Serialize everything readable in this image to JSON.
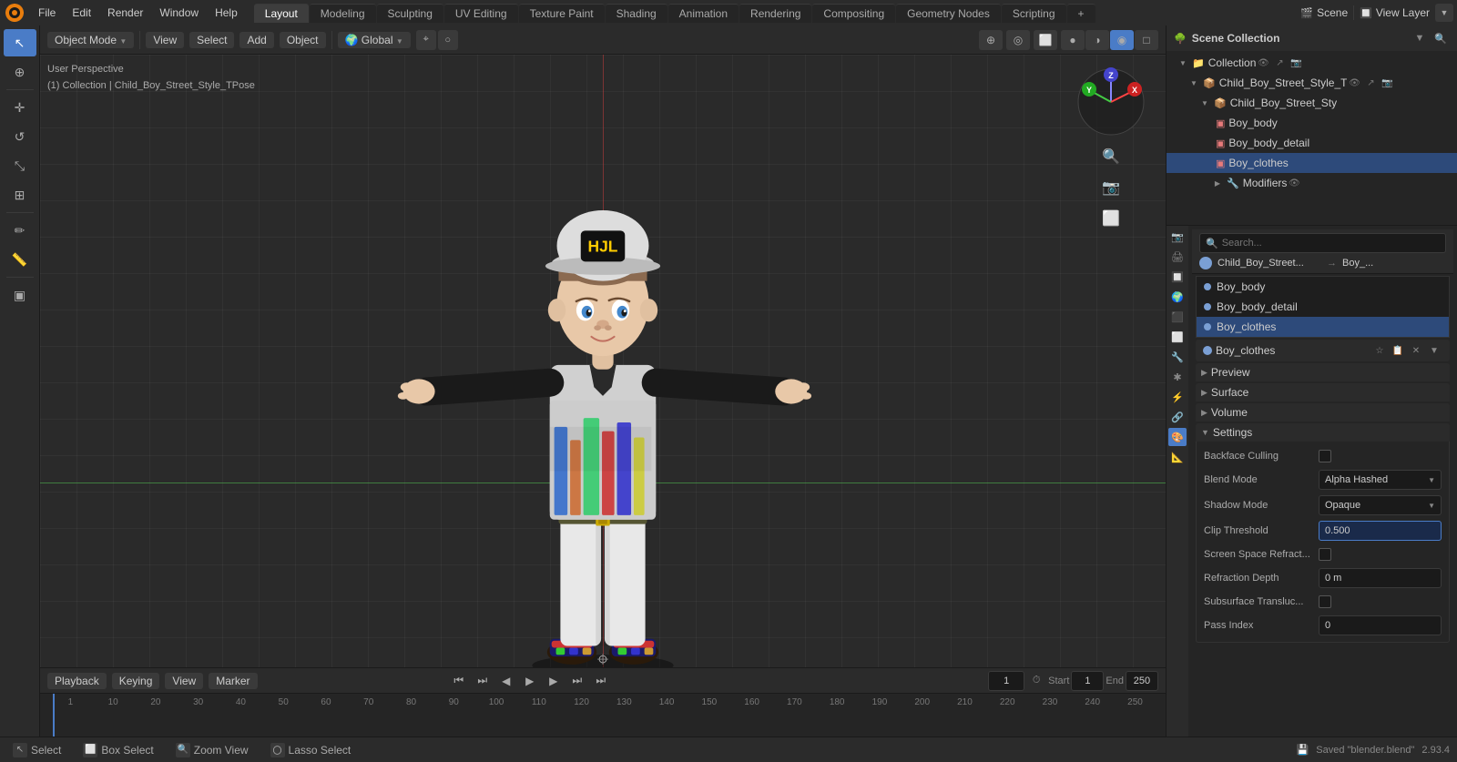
{
  "app": {
    "name": "Blender",
    "version": "2.93.4"
  },
  "topmenu": {
    "items": [
      "Blender",
      "File",
      "Edit",
      "Render",
      "Window",
      "Help"
    ],
    "workspace_tabs": [
      "Layout",
      "Modeling",
      "Sculpting",
      "UV Editing",
      "Texture Paint",
      "Shading",
      "Animation",
      "Rendering",
      "Compositing",
      "Geometry Nodes",
      "Scripting"
    ],
    "active_tab": "Layout",
    "scene_label": "Scene",
    "view_layer_label": "View Layer",
    "add_tab": "+"
  },
  "viewport_header": {
    "object_mode": "Object Mode",
    "view": "View",
    "select": "Select",
    "add": "Add",
    "object": "Object",
    "transform": "Global",
    "snap_icon": "⌖",
    "proportional": "○"
  },
  "viewport": {
    "info_line1": "User Perspective",
    "info_line2": "(1) Collection | Child_Boy_Street_Style_TPose",
    "gizmo_x": "X",
    "gizmo_y": "Y",
    "gizmo_z": "Z"
  },
  "tools": {
    "items": [
      {
        "name": "select",
        "icon": "↖",
        "active": true
      },
      {
        "name": "cursor",
        "icon": "⊕"
      },
      {
        "name": "move",
        "icon": "✛"
      },
      {
        "name": "rotate",
        "icon": "↺"
      },
      {
        "name": "scale",
        "icon": "⤡"
      },
      {
        "name": "transform",
        "icon": "⊠"
      },
      {
        "name": "annotate",
        "icon": "✏"
      },
      {
        "name": "measure",
        "icon": "📏"
      },
      {
        "name": "cube",
        "icon": "▣"
      }
    ]
  },
  "outliner": {
    "title": "Scene Collection",
    "items": [
      {
        "label": "Collection",
        "level": 0,
        "arrow": "▼",
        "dot_color": "#888888",
        "visible": true,
        "selected": false
      },
      {
        "label": "Child_Boy_Street_Style_T",
        "level": 1,
        "arrow": "▼",
        "dot_color": "#7777cc",
        "visible": true,
        "selected": false
      },
      {
        "label": "Child_Boy_Street_Sty",
        "level": 2,
        "arrow": "▼",
        "dot_color": "#7777cc",
        "visible": true,
        "selected": false
      },
      {
        "label": "Boy_body",
        "level": 3,
        "arrow": "",
        "dot_color": "#e87a7a",
        "visible": true,
        "selected": false
      },
      {
        "label": "Boy_body_detail",
        "level": 3,
        "arrow": "",
        "dot_color": "#e87a7a",
        "visible": true,
        "selected": false
      },
      {
        "label": "Boy_clothes",
        "level": 3,
        "arrow": "",
        "dot_color": "#e87a7a",
        "visible": true,
        "selected": false
      },
      {
        "label": "Modifiers",
        "level": 3,
        "arrow": "▶",
        "dot_color": "#888888",
        "visible": true,
        "selected": false
      }
    ]
  },
  "properties": {
    "search_placeholder": "Search...",
    "obj_name": "Child_Boy_Street...",
    "mat_name": "Boy_...",
    "icons": [
      "🎬",
      "📷",
      "🌊",
      "🔧",
      "✱",
      "🎨",
      "📐",
      "🔑",
      "⚡",
      "⬛",
      "🔵"
    ],
    "material_list": [
      {
        "name": "Boy_body",
        "dot_color": "#7a9fd4",
        "selected": false
      },
      {
        "name": "Boy_body_detail",
        "dot_color": "#7a9fd4",
        "selected": false
      },
      {
        "name": "Boy_clothes",
        "dot_color": "#7a9fd4",
        "selected": true
      }
    ],
    "active_material": "Boy_clothes",
    "active_material_dot": "#7a9fd4",
    "sections": {
      "preview": "Preview",
      "surface": "Surface",
      "volume": "Volume",
      "settings": "Settings"
    },
    "settings": {
      "backface_culling_label": "Backface Culling",
      "backface_culling_checked": false,
      "blend_mode_label": "Blend Mode",
      "blend_mode_value": "Alpha Hashed",
      "shadow_mode_label": "Shadow Mode",
      "shadow_mode_value": "Opaque",
      "clip_threshold_label": "Clip Threshold",
      "clip_threshold_value": "0.500",
      "screen_space_refract_label": "Screen Space Refract...",
      "screen_space_refract_checked": false,
      "refraction_depth_label": "Refraction Depth",
      "refraction_depth_value": "0 m",
      "subsurface_transluc_label": "Subsurface Transluc...",
      "subsurface_transluc_checked": false,
      "pass_index_label": "Pass Index",
      "pass_index_value": "0"
    }
  },
  "timeline": {
    "playback": "Playback",
    "keying": "Keying",
    "view": "View",
    "marker": "Marker",
    "current_frame": "1",
    "start_frame": "1",
    "end_frame": "250",
    "marks": [
      "1",
      "10",
      "20",
      "30",
      "40",
      "50",
      "60",
      "70",
      "80",
      "90",
      "100",
      "110",
      "120",
      "130",
      "140",
      "150",
      "160",
      "170",
      "180",
      "190",
      "200",
      "210",
      "220",
      "230",
      "240",
      "250"
    ]
  },
  "bottom_bar": {
    "select": "Select",
    "box_select": "Box Select",
    "zoom_view": "Zoom View",
    "lasso_select": "Lasso Select",
    "saved_status": "Saved \"blender.blend\"",
    "version": "2.93.4"
  }
}
